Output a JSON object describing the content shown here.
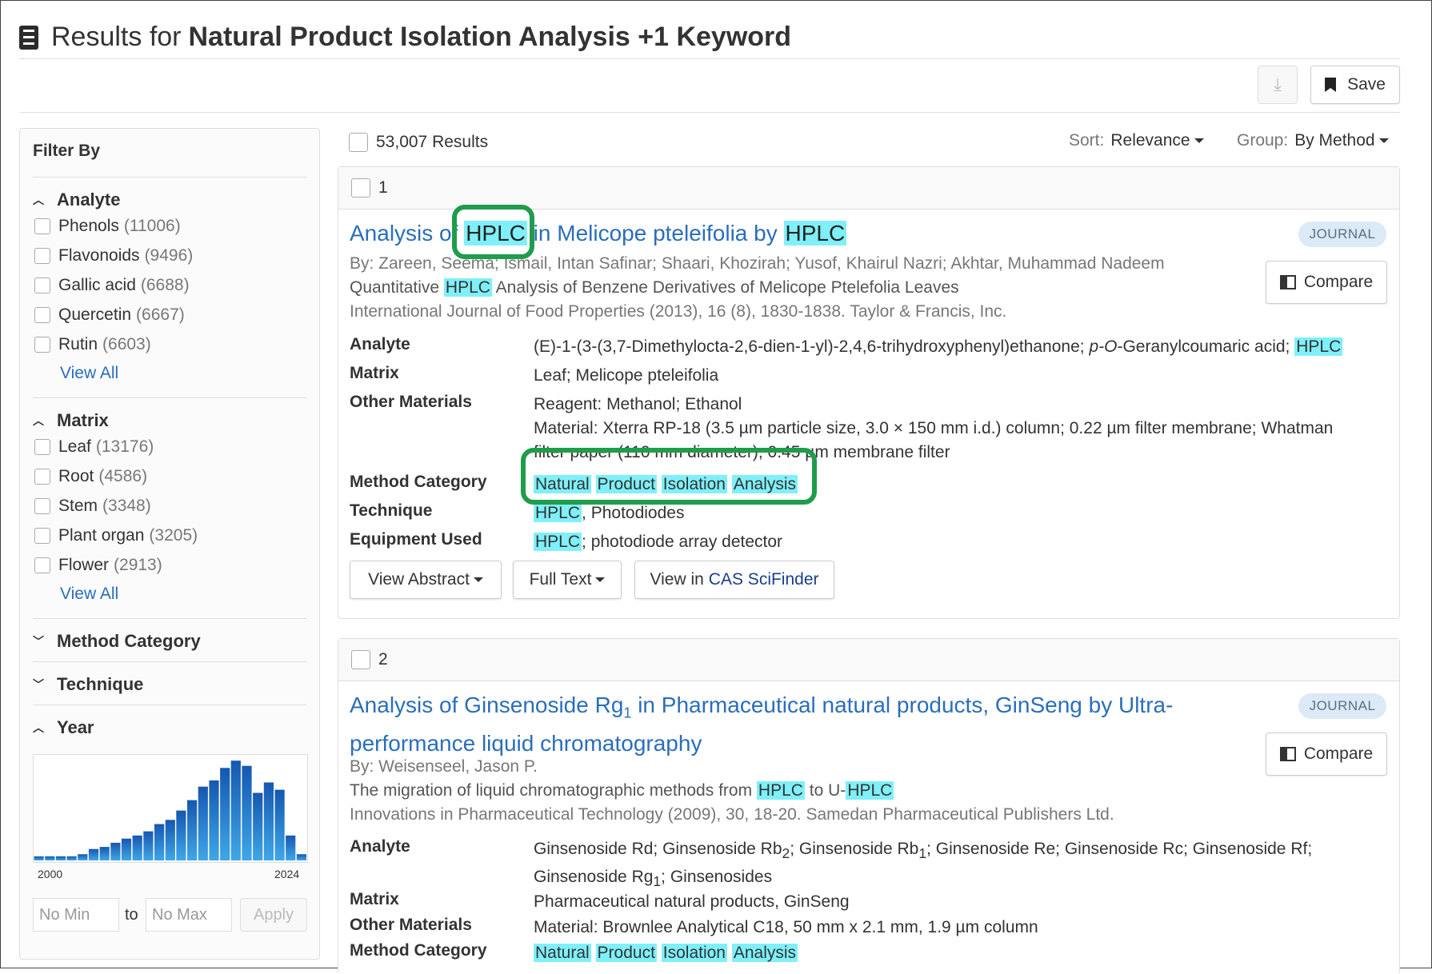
{
  "header": {
    "prefix": "Results for",
    "query": "Natural Product Isolation Analysis +1 Keyword",
    "save_label": "Save",
    "download_icon": "download-icon",
    "bookmark_icon": "bookmark-icon"
  },
  "filters": {
    "title": "Filter By",
    "analyte": {
      "label": "Analyte",
      "items": [
        {
          "name": "Phenols",
          "count": "(11006)"
        },
        {
          "name": "Flavonoids",
          "count": "(9496)"
        },
        {
          "name": "Gallic acid",
          "count": "(6688)"
        },
        {
          "name": "Quercetin",
          "count": "(6667)"
        },
        {
          "name": "Rutin",
          "count": "(6603)"
        }
      ],
      "view_all": "View All"
    },
    "matrix": {
      "label": "Matrix",
      "items": [
        {
          "name": "Leaf",
          "count": "(13176)"
        },
        {
          "name": "Root",
          "count": "(4586)"
        },
        {
          "name": "Stem",
          "count": "(3348)"
        },
        {
          "name": "Plant organ",
          "count": "(3205)"
        },
        {
          "name": "Flower",
          "count": "(2913)"
        }
      ],
      "view_all": "View All"
    },
    "method_category": {
      "label": "Method Category"
    },
    "technique": {
      "label": "Technique"
    },
    "year": {
      "label": "Year",
      "start_label": "2000",
      "end_label": "2024",
      "min_placeholder": "No Min",
      "max_placeholder": "No Max",
      "to_label": "to",
      "apply_label": "Apply"
    }
  },
  "chart_data": {
    "type": "bar",
    "categories": [
      "2000",
      "2001",
      "2002",
      "2003",
      "2004",
      "2005",
      "2006",
      "2007",
      "2008",
      "2009",
      "2010",
      "2011",
      "2012",
      "2013",
      "2014",
      "2015",
      "2016",
      "2017",
      "2018",
      "2019",
      "2020",
      "2021",
      "2022",
      "2023",
      "2024"
    ],
    "values": [
      4,
      4,
      4,
      4,
      6,
      11,
      13,
      17,
      21,
      24,
      28,
      35,
      39,
      48,
      58,
      71,
      77,
      89,
      96,
      91,
      65,
      75,
      68,
      24,
      6
    ],
    "ylim": [
      0,
      100
    ],
    "color_top": "#1557b0",
    "color_bottom": "#3fa7e8",
    "grid": false
  },
  "results_bar": {
    "count_label": "53,007 Results",
    "sort_label": "Sort:",
    "sort_value": "Relevance",
    "group_label": "Group:",
    "group_value": "By Method"
  },
  "results": [
    {
      "index": "1",
      "badge": "JOURNAL",
      "compare_label": "Compare",
      "title": {
        "p1": "Analysis of",
        "hl1": "HPLC",
        "p2": "in Melicope pteleifolia by",
        "hl2": "HPLC"
      },
      "authors": "By: Zareen, Seema; Ismail, Intan Safinar; Shaari, Khozirah; Yusof, Khairul Nazri; Akhtar, Muhammad Nadeem",
      "subtitle": {
        "hl": "HPLC",
        "p1": "Quantitative",
        "p2": "Analysis of Benzene Derivatives of Melicope Ptelefolia Leaves"
      },
      "journal": "International Journal of Food Properties (2013), 16 (8), 1830-1838. Taylor & Francis, Inc.",
      "analyte_label": "Analyte",
      "analyte": {
        "p1": "(E)-1-(3-(3,7-Dimethylocta-2,6-dien-1-yl)-2,4,6-trihydroxyphenyl)ethanone;",
        "it": "p-O",
        "p2": "-Geranylcoumaric acid;",
        "hl": "HPLC"
      },
      "matrix_label": "Matrix",
      "matrix": "Leaf; Melicope pteleifolia",
      "other_label": "Other Materials",
      "other1": "Reagent: Methanol; Ethanol",
      "other2": "Material: Xterra RP-18 (3.5 µm particle size, 3.0 × 150 mm i.d.) column; 0.22 µm filter membrane; Whatman",
      "other3": "filter paper (110 mm diameter); 0.45 µm membrane filter",
      "method_label": "Method Category",
      "method": [
        "Natural",
        "Product",
        "Isolation",
        "Analysis"
      ],
      "technique_label": "Technique",
      "technique": {
        "hl": "HPLC",
        "p": ", Photodiodes"
      },
      "equipment_label": "Equipment Used",
      "equipment": {
        "hl": "HPLC",
        "p": "; photodiode array detector"
      },
      "buttons": {
        "abstract": "View Abstract",
        "fulltext": "Full Text",
        "cas_prefix": "View in",
        "cas_brand": "CAS SciFinder"
      }
    },
    {
      "index": "2",
      "badge": "JOURNAL",
      "compare_label": "Compare",
      "title": {
        "p1": "Analysis of Ginsenoside Rg",
        "sub": "1",
        "p2": " in Pharmaceutical natural products, GinSeng by Ultra-performance liquid chromatography"
      },
      "authors": "By: Weisenseel, Jason P.",
      "subtitle": {
        "p1": "The migration of liquid chromatographic methods from",
        "hl1": "HPLC",
        "p2": "to U-",
        "hl2": "HPLC"
      },
      "journal": "Innovations in Pharmaceutical Technology (2009), 30, 18-20. Samedan Pharmaceutical Publishers Ltd.",
      "analyte_label": "Analyte",
      "analyte": {
        "a": "Ginsenoside Rd; Ginsenoside Rb",
        "s1": "2",
        "b": "; Ginsenoside Rb",
        "s2": "1",
        "c": "; Ginsenoside Re; Ginsenoside Rc; Ginsenoside Rf;",
        "d": "Ginsenoside Rg",
        "s3": "1",
        "e": "; Ginsenosides"
      },
      "matrix_label": "Matrix",
      "matrix": "Pharmaceutical natural products, GinSeng",
      "other_label": "Other Materials",
      "other1": "Material: Brownlee Analytical C18, 50 mm x 2.1 mm, 1.9 µm column",
      "method_label": "Method Category",
      "method": [
        "Natural",
        "Product",
        "Isolation",
        "Analysis"
      ]
    }
  ]
}
